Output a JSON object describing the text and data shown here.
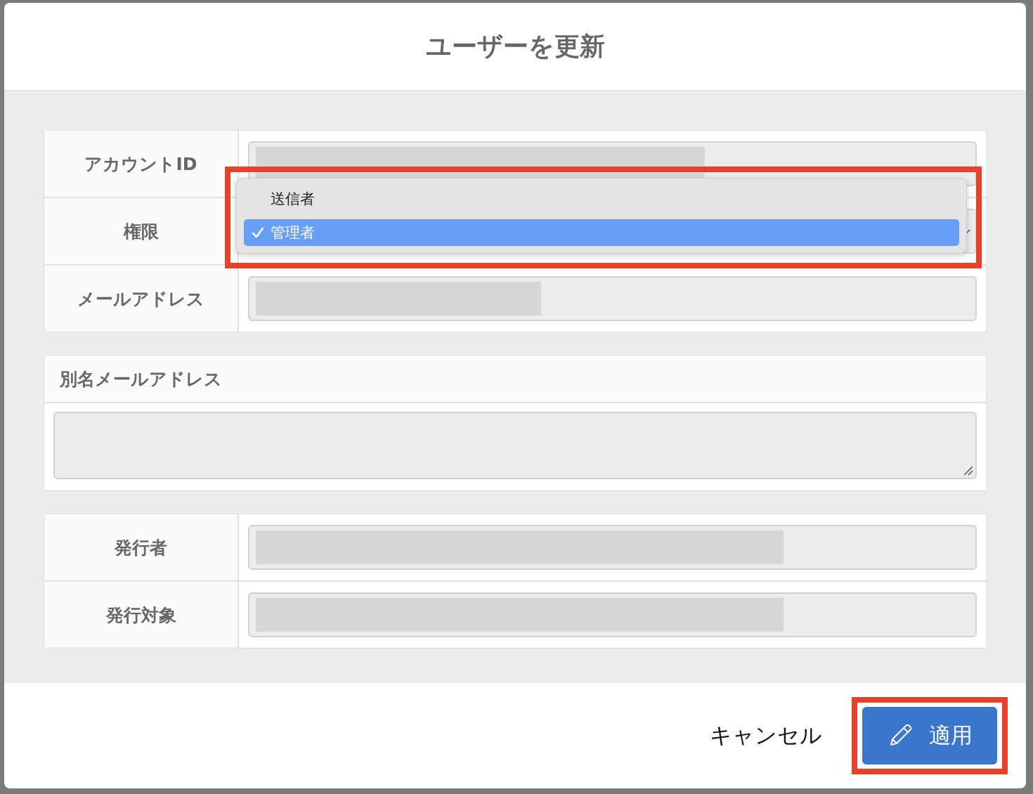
{
  "dialog": {
    "title": "ユーザーを更新"
  },
  "fields": [
    {
      "label": "アカウントID",
      "kind": "input"
    },
    {
      "label": "権限",
      "kind": "select"
    },
    {
      "label": "メールアドレス",
      "kind": "input"
    }
  ],
  "dropdown": {
    "options": [
      {
        "label": "送信者",
        "selected": false
      },
      {
        "label": "管理者",
        "selected": true
      }
    ]
  },
  "alias": {
    "label": "別名メールアドレス"
  },
  "issue_fields": [
    {
      "label": "発行者",
      "kind": "input"
    },
    {
      "label": "発行対象",
      "kind": "input"
    }
  ],
  "footer": {
    "cancel": "キャンセル",
    "apply": "適用"
  }
}
